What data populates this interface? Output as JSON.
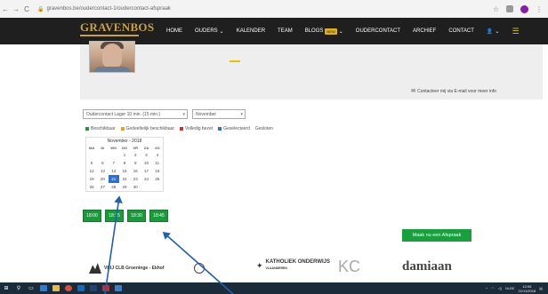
{
  "browser": {
    "url": "gravenbos.be/oudercontact-1/oudercontact-afspraak"
  },
  "site": {
    "logo_text": "GRAVENBOS",
    "nav": [
      {
        "label": "HOME"
      },
      {
        "label": "OUDERS",
        "has_dropdown": true
      },
      {
        "label": "KALENDER"
      },
      {
        "label": "TEAM"
      },
      {
        "label": "BLOGS",
        "badge": "NEW",
        "has_dropdown": true
      },
      {
        "label": "OUDERCONTACT"
      },
      {
        "label": "ARCHIEF"
      },
      {
        "label": "CONTACT"
      }
    ]
  },
  "contact_note": "Contacteer mij via E-mail voor meer info",
  "selects": {
    "type": "Oudercontact Lager 10 min. (15 min.)",
    "month": "November"
  },
  "legend": [
    {
      "label": "Beschikbaar",
      "color": "#1a9a3a"
    },
    {
      "label": "Gedeeltelijk beschikbaar",
      "color": "#e8a21c"
    },
    {
      "label": "Volledig bezet",
      "color": "#d62f2f"
    },
    {
      "label": "Geselecteerd",
      "color": "#2f6fd0"
    },
    {
      "label": "Gesloten",
      "color": ""
    }
  ],
  "calendar": {
    "title": "November - 2018",
    "weekdays": [
      "MA",
      "DI",
      "WO",
      "DO",
      "VR",
      "ZA",
      "ZO"
    ],
    "weeks": [
      [
        "",
        "",
        "",
        "1",
        "2",
        "3",
        "4"
      ],
      [
        "5",
        "6",
        "7",
        "8",
        "9",
        "10",
        "11"
      ],
      [
        "12",
        "13",
        "14",
        "15",
        "16",
        "17",
        "18"
      ],
      [
        "19",
        "20",
        "21",
        "22",
        "23",
        "24",
        "25"
      ],
      [
        "26",
        "27",
        "28",
        "29",
        "30",
        "",
        ""
      ]
    ],
    "selected": "21"
  },
  "slots": [
    "18:00",
    "18:15",
    "18:30",
    "18:45"
  ],
  "cta_label": "Maak nu een Afspraak",
  "footer": {
    "clb_text": "VRIJ CLB Groeninge - Ekhof",
    "ko_text": "KATHOLIEK ONDERWIJS",
    "ko_sub": "VLAANDEREN",
    "kc_text": "KC",
    "damiaan_text": "damiaan"
  },
  "taskbar": {
    "time": "12:06",
    "date": "21/11/2018",
    "lang": "NLBE"
  }
}
